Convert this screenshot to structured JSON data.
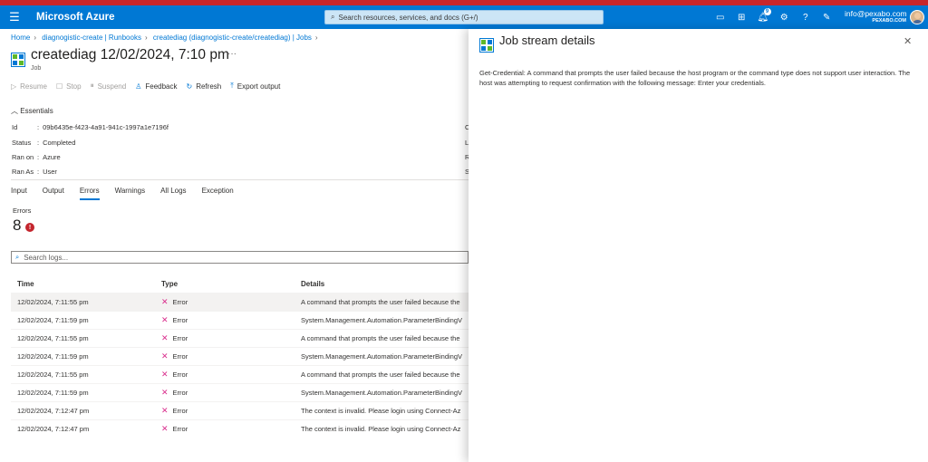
{
  "topbar": {
    "brand": "Microsoft Azure",
    "search_placeholder": "Search resources, services, and docs (G+/)",
    "notification_count": "9",
    "user_email": "info@pexabo.com",
    "user_org": "PEXABO.COM"
  },
  "breadcrumb": {
    "items": [
      "Home",
      "diagnogistic-create | Runbooks",
      "creatediag (diagnogistic-create/creatediag) | Jobs"
    ]
  },
  "page": {
    "title": "creatediag 12/02/2024, 7:10 pm",
    "subtitle": "Job",
    "more": "···"
  },
  "toolbar": {
    "resume": "Resume",
    "stop": "Stop",
    "suspend": "Suspend",
    "feedback": "Feedback",
    "refresh": "Refresh",
    "export": "Export output"
  },
  "essentials": {
    "header": "Essentials",
    "rows": [
      {
        "key": "Id",
        "value": "09b6435e-f423-4a91-941c-1997a1e7196f",
        "right": "C"
      },
      {
        "key": "Status",
        "value": "Completed",
        "right": "L"
      },
      {
        "key": "Ran on",
        "value": "Azure",
        "right": "R"
      },
      {
        "key": "Ran As",
        "value": "User",
        "right": "S"
      }
    ]
  },
  "tabs": [
    "Input",
    "Output",
    "Errors",
    "Warnings",
    "All Logs",
    "Exception"
  ],
  "errors": {
    "label": "Errors",
    "count": "8",
    "badge": "!"
  },
  "search_logs": {
    "placeholder": "Search logs..."
  },
  "table": {
    "headers": {
      "time": "Time",
      "type": "Type",
      "details": "Details"
    },
    "rows": [
      {
        "time": "12/02/2024, 7:11:55 pm",
        "type": "Error",
        "details": "A command that prompts the user failed because the"
      },
      {
        "time": "12/02/2024, 7:11:59 pm",
        "type": "Error",
        "details": "System.Management.Automation.ParameterBindingV"
      },
      {
        "time": "12/02/2024, 7:11:55 pm",
        "type": "Error",
        "details": "A command that prompts the user failed because the"
      },
      {
        "time": "12/02/2024, 7:11:59 pm",
        "type": "Error",
        "details": "System.Management.Automation.ParameterBindingV"
      },
      {
        "time": "12/02/2024, 7:11:55 pm",
        "type": "Error",
        "details": "A command that prompts the user failed because the"
      },
      {
        "time": "12/02/2024, 7:11:59 pm",
        "type": "Error",
        "details": "System.Management.Automation.ParameterBindingV"
      },
      {
        "time": "12/02/2024, 7:12:47 pm",
        "type": "Error",
        "details": "The context is invalid. Please login using Connect-Az"
      },
      {
        "time": "12/02/2024, 7:12:47 pm",
        "type": "Error",
        "details": "The context is invalid. Please login using Connect-Az"
      }
    ]
  },
  "panel": {
    "title": "Job stream details",
    "body": "Get-Credential: A command that prompts the user failed because the host program or the command type does not support user interaction. The host was attempting to request confirmation with the following message: Enter your credentials."
  },
  "colors": {
    "accent": "#0078d4",
    "topbar_stripe": "#c8262b",
    "error_x": "#d92c8c",
    "error_badge": "#c4262e"
  }
}
